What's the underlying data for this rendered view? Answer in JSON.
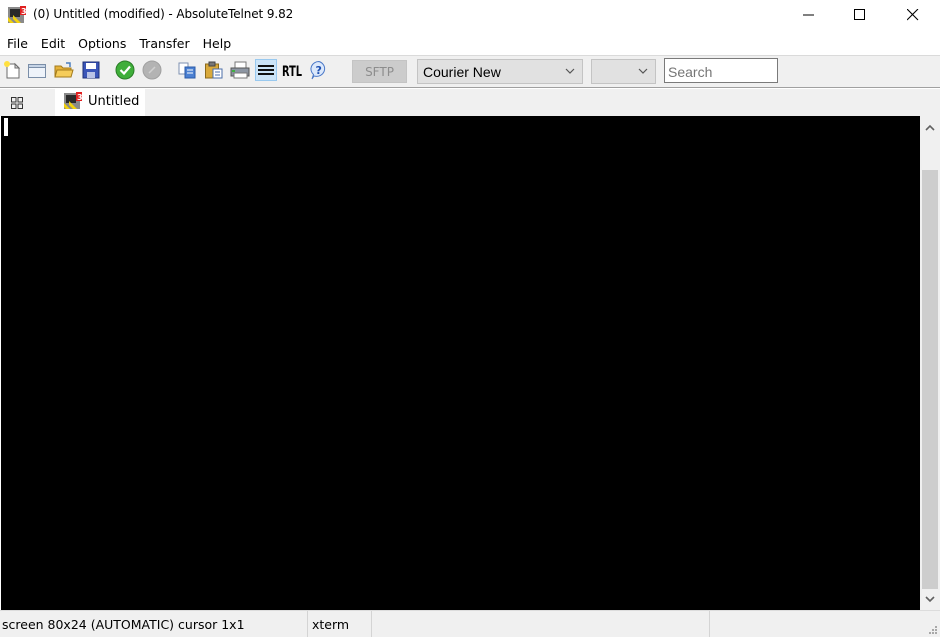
{
  "window": {
    "title": "(0) Untitled (modified) - AbsoluteTelnet 9.82",
    "app_icon": "absolutetelnet-icon",
    "controls": {
      "minimize": "minimize-icon",
      "maximize": "maximize-icon",
      "close": "close-icon"
    }
  },
  "menubar": {
    "items": [
      {
        "label": "File"
      },
      {
        "label": "Edit"
      },
      {
        "label": "Options"
      },
      {
        "label": "Transfer"
      },
      {
        "label": "Help"
      }
    ]
  },
  "toolbar": {
    "buttons": [
      {
        "name": "new",
        "icon": "new-document-icon"
      },
      {
        "name": "new-window",
        "icon": "new-window-icon"
      },
      {
        "name": "open",
        "icon": "open-folder-icon"
      },
      {
        "name": "save",
        "icon": "save-icon"
      },
      {
        "name": "connect",
        "icon": "connect-check-icon"
      },
      {
        "name": "disconnect",
        "icon": "disconnect-icon",
        "disabled": true
      },
      {
        "name": "copy",
        "icon": "copy-icon"
      },
      {
        "name": "paste",
        "icon": "paste-icon"
      },
      {
        "name": "print",
        "icon": "print-icon"
      },
      {
        "name": "wrap",
        "icon": "text-lines-icon",
        "active": true
      },
      {
        "name": "rtl",
        "icon": "rtl-icon",
        "label": "RTL"
      },
      {
        "name": "help",
        "icon": "help-icon",
        "label": "?"
      }
    ],
    "sftp_label": "SFTP",
    "font_select": {
      "value": "Courier New"
    },
    "size_select": {
      "value": ""
    },
    "search": {
      "value": "",
      "placeholder": "Search"
    }
  },
  "tabs": {
    "grid_icon": "tab-grid-icon",
    "items": [
      {
        "label": "Untitled",
        "icon": "absolutetelnet-icon",
        "active": true
      }
    ]
  },
  "terminal": {
    "background": "#000000",
    "cursor_color": "#ffffff",
    "content": ""
  },
  "scrollbar": {
    "thumb_start_fraction": 0.07,
    "thumb_size_fraction": 0.93
  },
  "statusbar": {
    "screen": "screen 80x24 (AUTOMATIC) cursor 1x1",
    "emulation": "xterm",
    "cell3": "",
    "cell4": ""
  }
}
